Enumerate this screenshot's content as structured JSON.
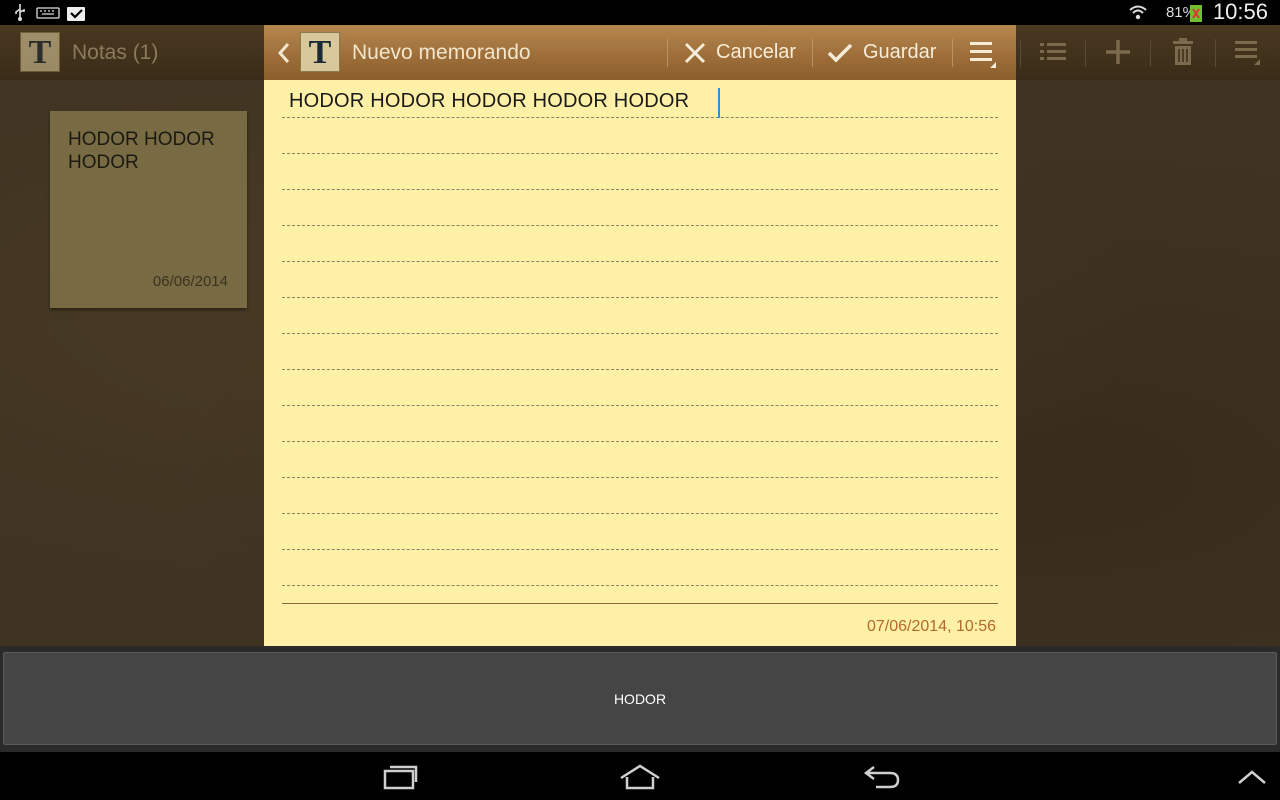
{
  "status_bar": {
    "battery_percent": "81%",
    "time": "10:56",
    "icons": [
      "usb-icon",
      "keyboard-icon",
      "store-bag-icon",
      "wifi-icon",
      "battery-charging-icon"
    ]
  },
  "left_panel": {
    "title": "Notas (1)",
    "logo_letter": "T",
    "toolbar_icons": [
      "list-view-icon",
      "add-icon",
      "delete-icon",
      "menu-icon"
    ],
    "notes": [
      {
        "text": "HODOR HODOR HODOR",
        "date": "06/06/2014"
      }
    ]
  },
  "editor": {
    "title": "Nuevo memorando",
    "logo_letter": "T",
    "cancel_label": "Cancelar",
    "save_label": "Guardar",
    "body_text": "HODOR HODOR HODOR HODOR HODOR",
    "timestamp": "07/06/2014,  10:56"
  },
  "keyboard": {
    "suggestion": "HODOR"
  },
  "colors": {
    "paper": "#fff0a8",
    "header_wood": "#a67540",
    "board": "#3f3322",
    "note_card": "#786b44",
    "caret": "#2f8fd7",
    "timestamp": "#b36a2a"
  }
}
